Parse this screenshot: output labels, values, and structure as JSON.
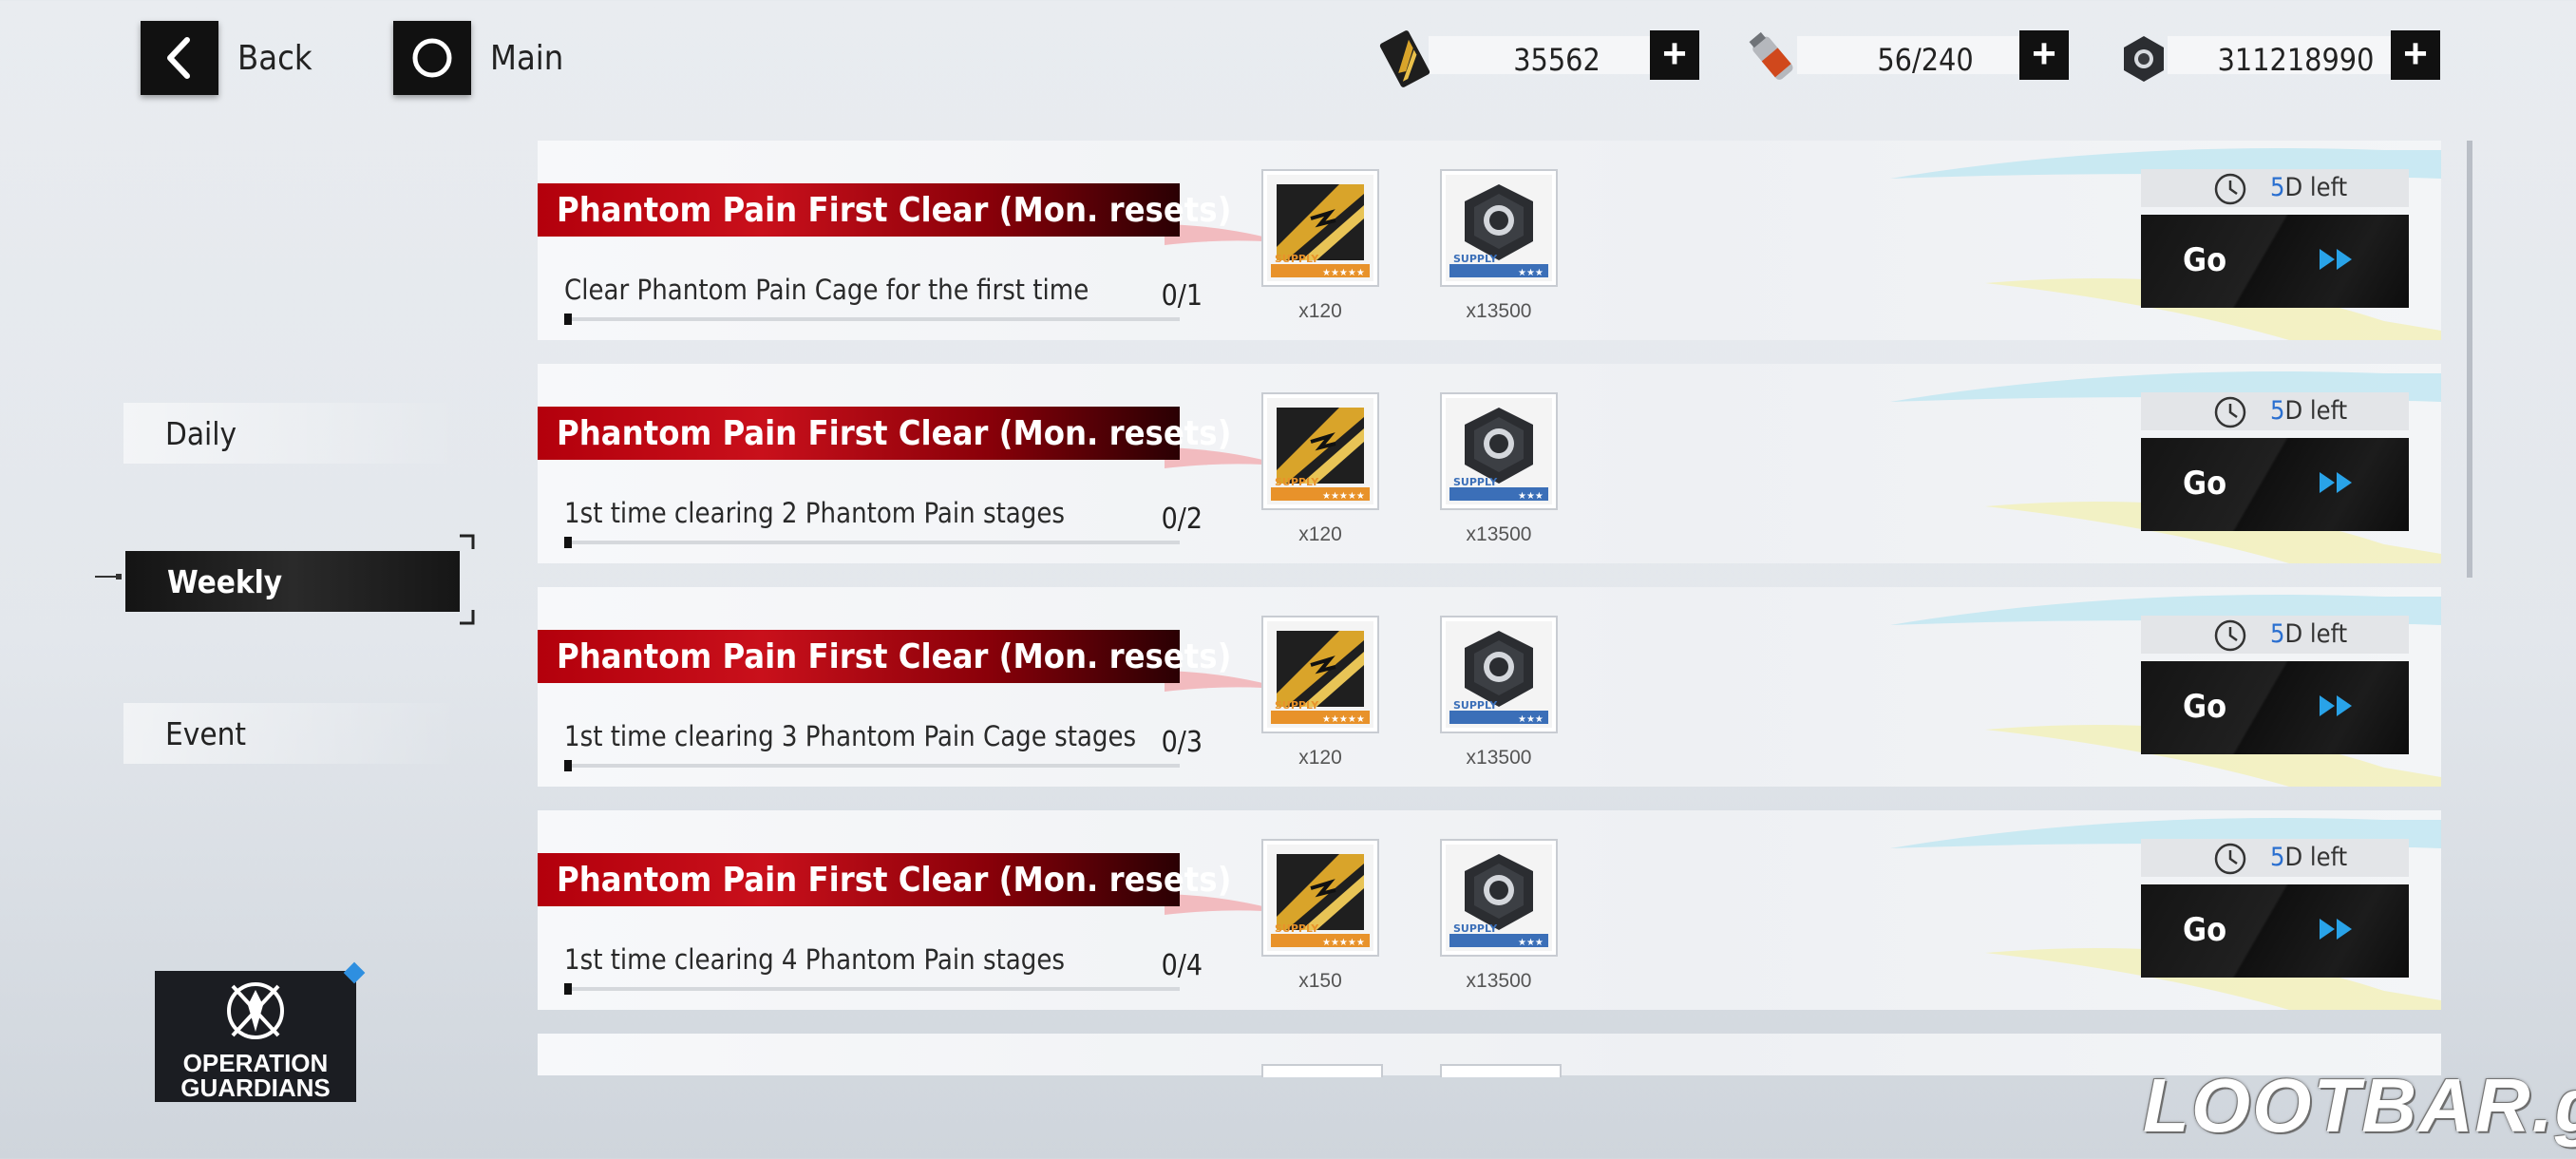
{
  "header": {
    "back_label": "Back",
    "main_label": "Main",
    "resources": [
      {
        "icon": "supply-card-icon",
        "value": "35562"
      },
      {
        "icon": "stamina-canister-icon",
        "value": "56/240"
      },
      {
        "icon": "hex-nut-icon",
        "value": "311218990"
      }
    ]
  },
  "tabs": [
    {
      "label": "Daily",
      "active": false
    },
    {
      "label": "Weekly",
      "active": true
    },
    {
      "label": "Event",
      "active": false
    }
  ],
  "tasks": [
    {
      "title": "Phantom Pain First Clear (Mon. resets)",
      "description": "Clear Phantom Pain Cage for the first time",
      "progress": "0/1",
      "rewards": [
        {
          "icon": "supply-card-icon",
          "qty": "x120"
        },
        {
          "icon": "hex-nut-icon",
          "qty": "x13500"
        }
      ],
      "timer_num": "5",
      "timer_text": "D left",
      "go_label": "Go"
    },
    {
      "title": "Phantom Pain First Clear (Mon. resets)",
      "description": "1st time clearing 2 Phantom Pain stages",
      "progress": "0/2",
      "rewards": [
        {
          "icon": "supply-card-icon",
          "qty": "x120"
        },
        {
          "icon": "hex-nut-icon",
          "qty": "x13500"
        }
      ],
      "timer_num": "5",
      "timer_text": "D left",
      "go_label": "Go"
    },
    {
      "title": "Phantom Pain First Clear (Mon. resets)",
      "description": "1st time clearing 3 Phantom Pain Cage stages",
      "progress": "0/3",
      "rewards": [
        {
          "icon": "supply-card-icon",
          "qty": "x120"
        },
        {
          "icon": "hex-nut-icon",
          "qty": "x13500"
        }
      ],
      "timer_num": "5",
      "timer_text": "D left",
      "go_label": "Go"
    },
    {
      "title": "Phantom Pain First Clear (Mon. resets)",
      "description": "1st time clearing 4 Phantom Pain stages",
      "progress": "0/4",
      "rewards": [
        {
          "icon": "supply-card-icon",
          "qty": "x150"
        },
        {
          "icon": "hex-nut-icon",
          "qty": "x13500"
        }
      ],
      "timer_num": "5",
      "timer_text": "D left",
      "go_label": "Go"
    }
  ],
  "event_logo": {
    "line1": "OPERATION",
    "line2": "GUARDIANS"
  },
  "watermark": "LOOTBAR.gg",
  "colors": {
    "title_red": "#c9101b",
    "accent_blue": "#2a6fd0",
    "go_arrow": "#29a3e8"
  }
}
